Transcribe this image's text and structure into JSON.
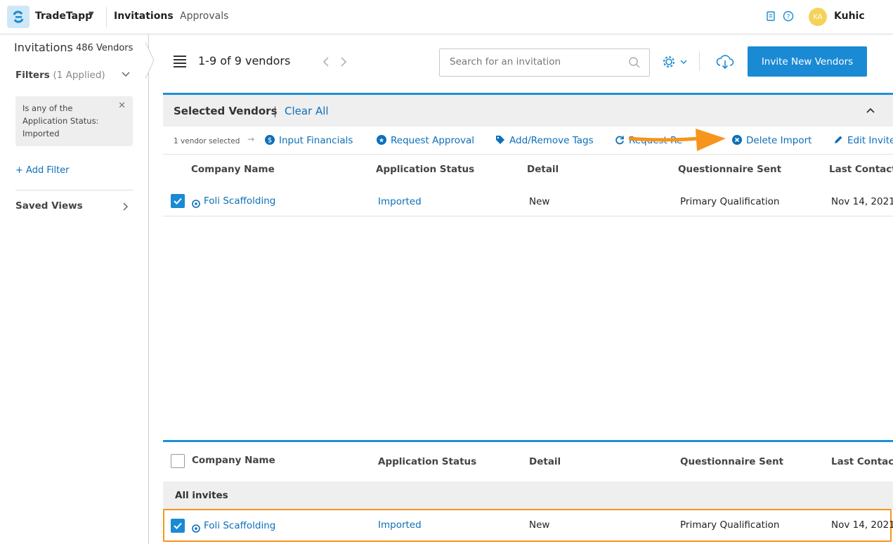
{
  "topbar": {
    "app_name": "TradeTapp",
    "nav_invitations": "Invitations",
    "nav_approvals": "Approvals",
    "avatar_initials": "KA",
    "user_name": "Kuhic"
  },
  "sidebar": {
    "title": "Invitations",
    "vendor_count": "486 Vendors",
    "filters_label": "Filters",
    "filters_applied": "(1 Applied)",
    "filter_chip_text": "Is any of the Application Status: Imported",
    "add_filter": "+ Add Filter",
    "saved_views": "Saved Views"
  },
  "toolbar": {
    "pager_text": "1-9 of 9 vendors",
    "search_placeholder": "Search for an invitation",
    "invite_button": "Invite New Vendors"
  },
  "selected_panel": {
    "title": "Selected Vendors",
    "separator": "|",
    "clear_all": "Clear All",
    "vendor_selected_text": "1 vendor selected",
    "actions": [
      {
        "label": "Input Financials",
        "icon": "dollar-circle-icon"
      },
      {
        "label": "Request Approval",
        "icon": "star-circle-icon"
      },
      {
        "label": "Add/Remove Tags",
        "icon": "tag-icon"
      },
      {
        "label": "Request Re",
        "icon": "refresh-icon"
      },
      {
        "label": "Delete Import",
        "icon": "x-circle-icon"
      },
      {
        "label": "Edit Invite",
        "icon": "pencil-icon"
      }
    ],
    "columns": [
      "Company Name",
      "Application Status",
      "Detail",
      "Questionnaire Sent",
      "Last Contacte"
    ],
    "rows": [
      {
        "company": "Foli Scaffolding",
        "status": "Imported",
        "detail": "New",
        "questionnaire": "Primary Qualification",
        "last_contacted": "Nov 14, 2021",
        "checked": true
      }
    ]
  },
  "bottom_table": {
    "columns": [
      "Company Name",
      "Application Status",
      "Detail",
      "Questionnaire Sent",
      "Last Contacte"
    ],
    "group_label": "All invites",
    "rows": [
      {
        "company": "Foli Scaffolding",
        "status": "Imported",
        "detail": "New",
        "questionnaire": "Primary Qualification",
        "last_contacted": "Nov 14, 2021",
        "checked": true
      }
    ]
  },
  "colors": {
    "accent": "#1a8ad4",
    "link": "#0d6fb8",
    "annotation": "#f7941d"
  }
}
